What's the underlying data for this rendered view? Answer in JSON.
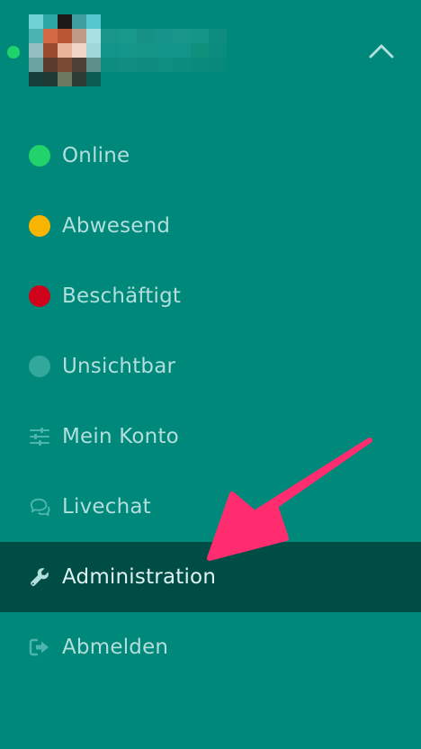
{
  "header": {
    "presence_color": "#1fd36b",
    "avatar_colors": [
      "#6fd3d6",
      "#2aa7a3",
      "#1b1a16",
      "#3f9fa0",
      "#55c7cc",
      "#49b3b1",
      "#d26a46",
      "#b85634",
      "#c09a86",
      "#a8dfe3",
      "#93bdc0",
      "#9a4a2e",
      "#e7b49a",
      "#f1d6c8",
      "#9fd6d8",
      "#6aa3a1",
      "#5a3c2e",
      "#7a4a35",
      "#4c3f36",
      "#5f8f8a",
      "#153f38",
      "#1f3a33",
      "#6c7a62",
      "#2a3c34",
      "#0b5b52"
    ],
    "username_blur_colors": [
      "#1a978b",
      "#1b998d",
      "#179386",
      "#18958a",
      "#1a978b",
      "#16958a",
      "#0f8d80",
      "#13968a",
      "#16988b",
      "#179689",
      "#14968a",
      "#13968a",
      "#10917f",
      "#0b8c7f",
      "#0e8e81",
      "#118f83",
      "#0f8d80",
      "#0e8f82",
      "#0d8d80",
      "#0b8b7e",
      "#0a8a7d"
    ],
    "chevron_icon": "chevron-up-icon"
  },
  "menu": {
    "items": [
      {
        "label": "Online",
        "icon": "status-dot",
        "color": "#21d36a",
        "active": false
      },
      {
        "label": "Abwesend",
        "icon": "status-dot",
        "color": "#f7b500",
        "active": false
      },
      {
        "label": "Beschäftigt",
        "icon": "status-dot",
        "color": "#d0021b",
        "active": false
      },
      {
        "label": "Unsichtbar",
        "icon": "status-dot",
        "color": "#32a89d",
        "active": false
      },
      {
        "label": "Mein Konto",
        "icon": "sliders-icon",
        "active": false
      },
      {
        "label": "Livechat",
        "icon": "chat-bubbles-icon",
        "active": false
      },
      {
        "label": "Administration",
        "icon": "wrench-icon",
        "active": true
      },
      {
        "label": "Abmelden",
        "icon": "sign-out-icon",
        "active": false
      }
    ]
  },
  "colors": {
    "background": "#00897b",
    "active_row": "#004d45",
    "label": "#b2dfdb",
    "icon": "#4db6ac",
    "arrow": "#ff2d6f"
  }
}
